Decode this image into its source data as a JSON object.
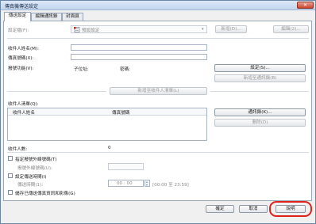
{
  "window": {
    "title": "傳真機傳送設定",
    "close_glyph": "✕"
  },
  "tabs": [
    {
      "label": "傳送設定"
    },
    {
      "label": "編輯通訊錄"
    },
    {
      "label": "封面頁"
    }
  ],
  "settings": {
    "label": "設定檔(F):",
    "value": "預設設定",
    "add_button": "新增(D)...",
    "edit_button": "編輯(2)..."
  },
  "recipient": {
    "name_label": "收件人姓名(M):",
    "number_label": "傳真號碼(X):",
    "dial_label": "撥號功能(V):",
    "subaddress_label": "子位址:",
    "password_label": "密碼:",
    "settings_button": "設定(S)...",
    "add_to_book_button": "新增至通訊錄(B)",
    "add_recipient_button": "新增至收件人清單(L)"
  },
  "list": {
    "label": "收件人清單(Q):",
    "columns": [
      "收件人姓名",
      "傳真號碼"
    ],
    "book_button": "通訊錄(K)...",
    "delete_button": "刪除(D)",
    "count_label": "收件人數:",
    "count_value": "0"
  },
  "options": {
    "outside_line_label": "指定撥號外線號碼(T)",
    "outside_prefix_label": "撥號外線號碼(U):",
    "time_label": "設定傳送時間(I)",
    "send_time_label": "傳送時間(1):",
    "time_value": "00 : 00",
    "time_range": "[00:00 至 23:59]",
    "store_label": "儲存已傳送傳真資訊和影像(G)"
  },
  "footer": {
    "ok_button": "確定",
    "cancel_button": "取消",
    "help_button": "說明"
  }
}
